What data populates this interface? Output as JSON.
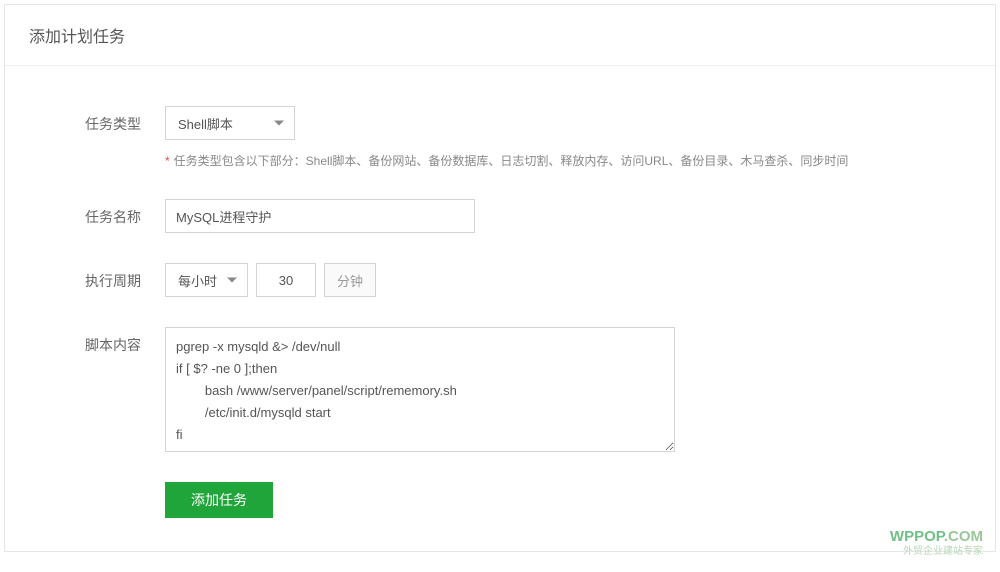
{
  "header": {
    "title": "添加计划任务"
  },
  "form": {
    "task_type": {
      "label": "任务类型",
      "value": "Shell脚本",
      "hint": "任务类型包含以下部分：Shell脚本、备份网站、备份数据库、日志切割、释放内存、访问URL、备份目录、木马查杀、同步时间"
    },
    "task_name": {
      "label": "任务名称",
      "value": "MySQL进程守护"
    },
    "cycle": {
      "label": "执行周期",
      "select_value": "每小时",
      "number_value": "30",
      "unit": "分钟"
    },
    "script": {
      "label": "脚本内容",
      "value": "pgrep -x mysqld &> /dev/null\nif [ $? -ne 0 ];then\n        bash /www/server/panel/script/rememory.sh\n        /etc/init.d/mysqld start\nfi"
    },
    "submit": {
      "label": "添加任务"
    }
  },
  "watermark": {
    "line1a": "WPPOP",
    "line1b": ".COM",
    "line2": "外贸企业建站专家"
  }
}
